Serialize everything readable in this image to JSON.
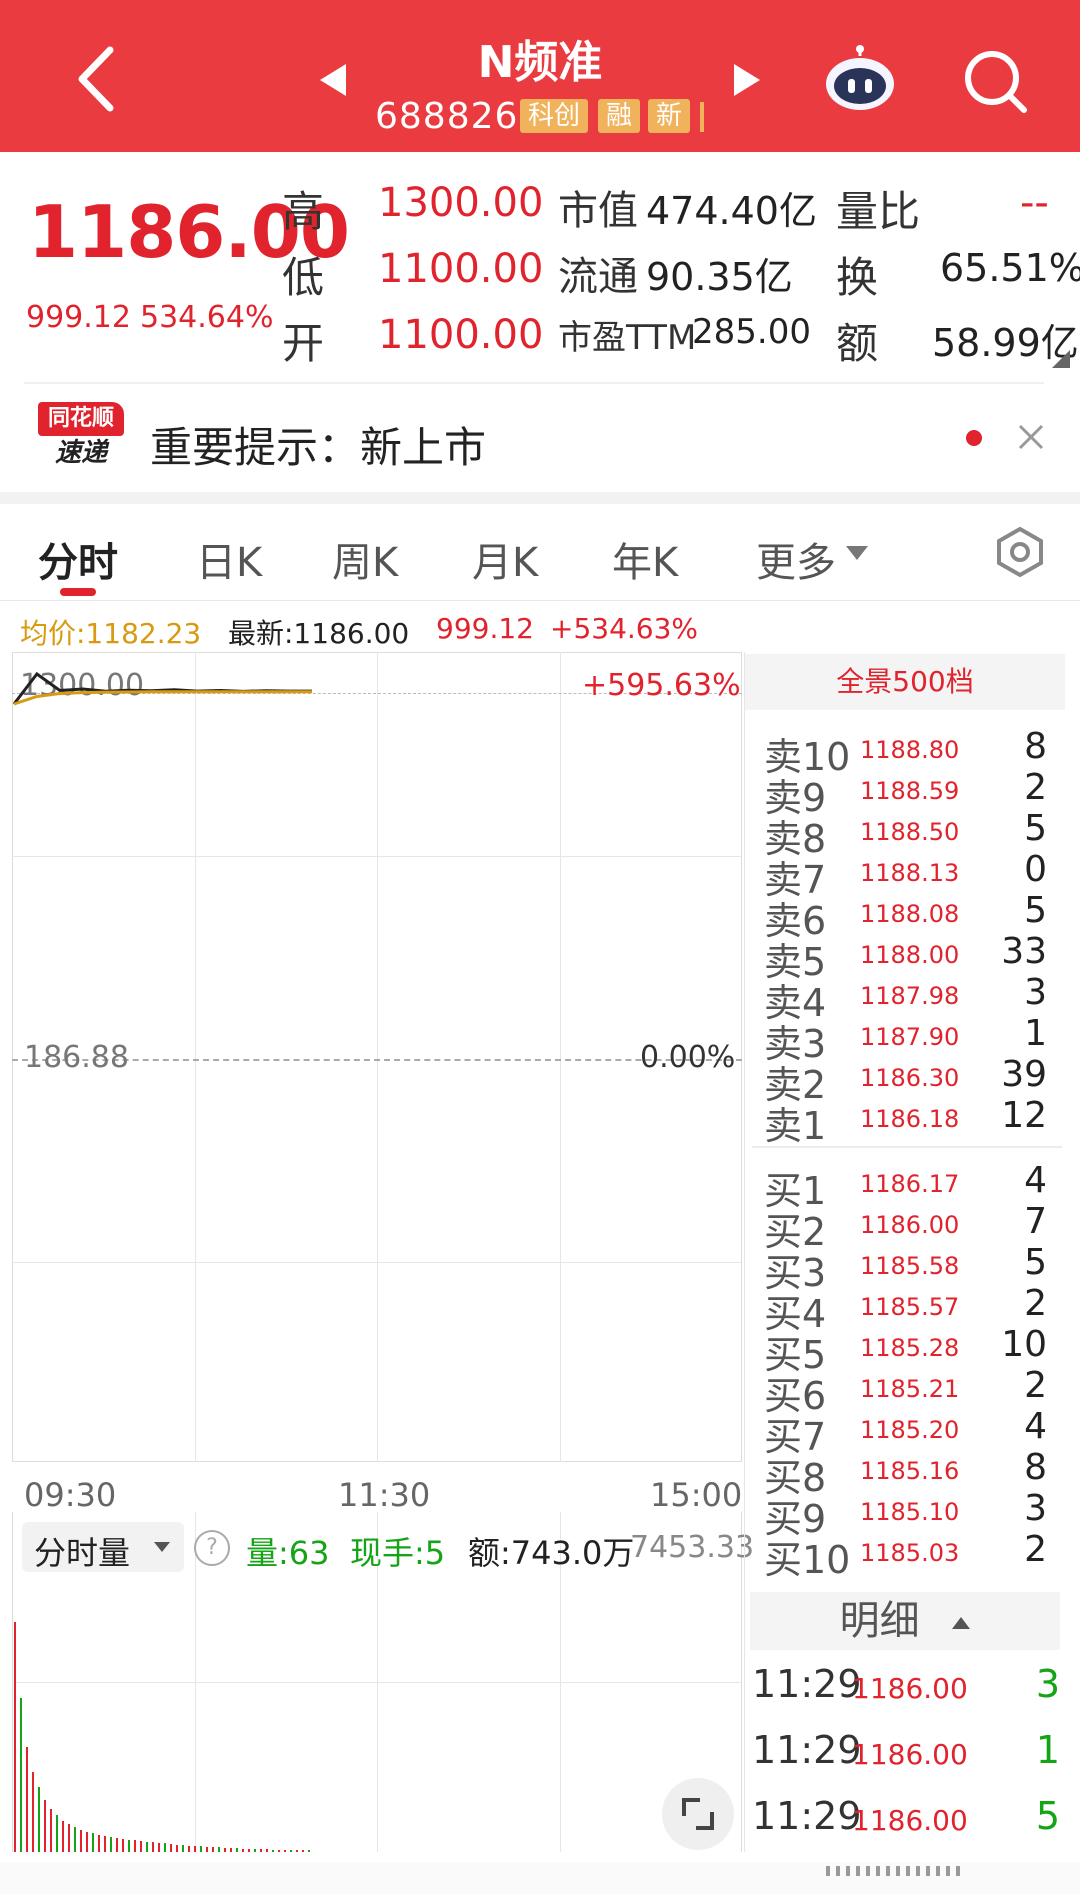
{
  "header": {
    "title": "N频准",
    "code": "688826",
    "tags": [
      "科创",
      "融",
      "新"
    ]
  },
  "quote": {
    "price": "1186.00",
    "change": "999.12",
    "change_pct": "534.64%",
    "high_label": "高",
    "high": "1300.00",
    "low_label": "低",
    "low": "1100.00",
    "open_label": "开",
    "open": "1100.00",
    "mcap_label": "市值",
    "mcap": "474.40亿",
    "float_label": "流通",
    "float": "90.35亿",
    "pe_label": "市盈TTM",
    "pe": "285.00",
    "vr_label": "量比",
    "vr": "--",
    "turnover_label": "换",
    "turnover": "65.51%",
    "amount_label": "额",
    "amount": "58.99亿"
  },
  "notice": {
    "logo_top": "同花顺",
    "logo_bottom": "速递",
    "text": "重要提示：新上市"
  },
  "tabs": [
    "分时",
    "日K",
    "周K",
    "月K",
    "年K",
    "更多"
  ],
  "info_line": {
    "avg": "均价:1182.23",
    "latest": "最新:1186.00",
    "change": "999.12",
    "change_pct": "+534.63%"
  },
  "chart_data": {
    "type": "line",
    "x_ticks": [
      "09:30",
      "11:30",
      "15:00"
    ],
    "y_top_label": "1300.00",
    "y_mid_label": "186.88",
    "pct_top_label": "+595.63%",
    "pct_mid_label": "0.00%",
    "series": [
      {
        "values": [
          1100,
          1300,
          1190,
          1200,
          1185,
          1192,
          1188,
          1195,
          1186,
          1190,
          1184,
          1189,
          1186,
          1186
        ]
      },
      {
        "values": [
          1100,
          1150,
          1170,
          1176,
          1179,
          1180,
          1181,
          1181,
          1182,
          1182,
          1182,
          1182,
          1182,
          1182
        ]
      }
    ],
    "volume_max_label": "7453.33",
    "volume": [
      7453,
      5000,
      3400,
      2600,
      2100,
      1700,
      1400,
      1200,
      1000,
      900,
      800,
      700,
      650,
      600,
      560,
      520,
      480,
      440,
      420,
      400,
      380,
      360,
      340,
      320,
      300,
      280,
      260,
      240,
      220,
      200,
      190,
      180,
      170,
      160,
      150,
      140,
      130,
      120,
      110,
      100,
      95,
      90,
      85,
      80,
      75,
      70,
      65,
      60,
      55,
      50
    ]
  },
  "volume_panel": {
    "selector": "分时量",
    "help": "?",
    "qty": "量:63",
    "hand": "现手:5",
    "amount": "额:743.0万"
  },
  "order_book": {
    "header": "全景500档",
    "asks": [
      {
        "label": "卖10",
        "price": "1188.80",
        "vol": "8"
      },
      {
        "label": "卖9",
        "price": "1188.59",
        "vol": "2"
      },
      {
        "label": "卖8",
        "price": "1188.50",
        "vol": "5"
      },
      {
        "label": "卖7",
        "price": "1188.13",
        "vol": "0"
      },
      {
        "label": "卖6",
        "price": "1188.08",
        "vol": "5"
      },
      {
        "label": "卖5",
        "price": "1188.00",
        "vol": "33"
      },
      {
        "label": "卖4",
        "price": "1187.98",
        "vol": "3"
      },
      {
        "label": "卖3",
        "price": "1187.90",
        "vol": "1"
      },
      {
        "label": "卖2",
        "price": "1186.30",
        "vol": "39"
      },
      {
        "label": "卖1",
        "price": "1186.18",
        "vol": "12"
      }
    ],
    "bids": [
      {
        "label": "买1",
        "price": "1186.17",
        "vol": "4"
      },
      {
        "label": "买2",
        "price": "1186.00",
        "vol": "7"
      },
      {
        "label": "买3",
        "price": "1185.58",
        "vol": "5"
      },
      {
        "label": "买4",
        "price": "1185.57",
        "vol": "2"
      },
      {
        "label": "买5",
        "price": "1185.28",
        "vol": "10"
      },
      {
        "label": "买6",
        "price": "1185.21",
        "vol": "2"
      },
      {
        "label": "买7",
        "price": "1185.20",
        "vol": "4"
      },
      {
        "label": "买8",
        "price": "1185.16",
        "vol": "8"
      },
      {
        "label": "买9",
        "price": "1185.10",
        "vol": "3"
      },
      {
        "label": "买10",
        "price": "1185.03",
        "vol": "2"
      }
    ]
  },
  "detail": {
    "header": "明细",
    "rows": [
      {
        "time": "11:29",
        "price": "1186.00",
        "vol": "3"
      },
      {
        "time": "11:29",
        "price": "1186.00",
        "vol": "1"
      },
      {
        "time": "11:29",
        "price": "1186.00",
        "vol": "5"
      }
    ]
  },
  "colors": {
    "brand_red": "#ea3b40",
    "up_red": "#e0232d",
    "avg_gold": "#d79a11",
    "down_green": "#15a415"
  }
}
